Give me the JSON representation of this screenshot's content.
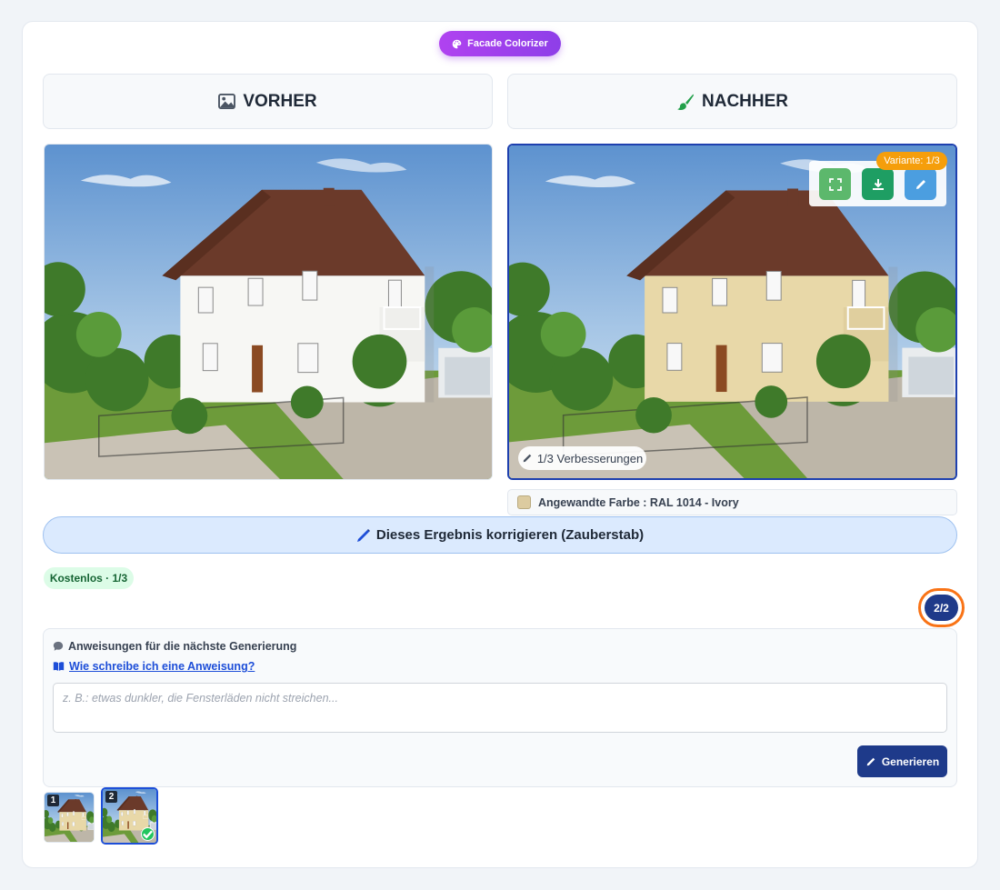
{
  "app": {
    "badge_label": "Facade Colorizer",
    "badge_icon": "palette-icon"
  },
  "panels": {
    "before": {
      "title": "VORHER",
      "icon": "image-icon"
    },
    "after": {
      "title": "NACHHER",
      "icon": "paint-brush-icon"
    }
  },
  "result": {
    "variant_label": "Variante: 1/3",
    "improvements_label": "1/3 Verbesserungen",
    "applied_color_label": "Angewandte Farbe : RAL 1014 - Ivory",
    "applied_color_hex": "#dccba0",
    "tools": [
      {
        "name": "fullscreen-button",
        "icon": "expand-icon",
        "color": "#5cb86c"
      },
      {
        "name": "download-button",
        "icon": "download-icon",
        "color": "#1e9e63"
      },
      {
        "name": "edit-button",
        "icon": "pencil-icon",
        "color": "#4b9ee0"
      }
    ]
  },
  "fix_button_label": "Dieses Ergebnis korrigieren (Zauberstab)",
  "free_badge": "Kostenlos · 1/3",
  "counter": "2/2",
  "instructions": {
    "title": "Anweisungen für die nächste Generierung",
    "help_link": "Wie schreibe ich eine Anweisung?",
    "placeholder": "z. B.: etwas dunkler, die Fensterläden nicht streichen...",
    "value": "",
    "generate_label": "Generieren"
  },
  "thumbnails": [
    {
      "number": "1",
      "selected": false
    },
    {
      "number": "2",
      "selected": true
    }
  ],
  "colors": {
    "accent": "#1e3a8a",
    "wall_before": "#f7f7f4",
    "wall_after": "#e8d8a8",
    "highlight": "#f97316"
  }
}
